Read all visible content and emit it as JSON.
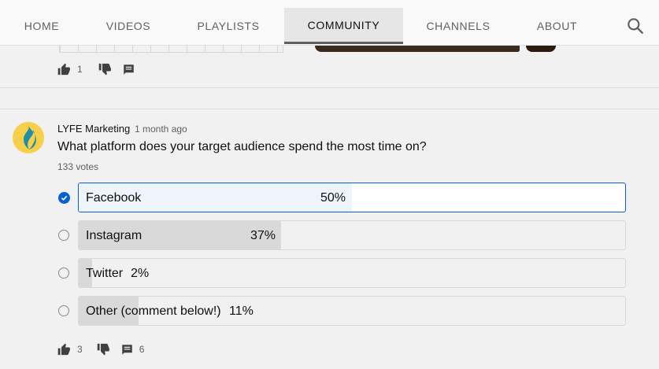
{
  "nav": {
    "tabs": [
      {
        "label": "HOME"
      },
      {
        "label": "VIDEOS"
      },
      {
        "label": "PLAYLISTS"
      },
      {
        "label": "COMMUNITY"
      },
      {
        "label": "CHANNELS"
      },
      {
        "label": "ABOUT"
      }
    ],
    "active_tab": "COMMUNITY",
    "search_icon": "search-icon"
  },
  "previous_post": {
    "likes": "1"
  },
  "post": {
    "author": "LYFE Marketing",
    "time": "1 month ago",
    "question": "What platform does your target audience spend the most time on?",
    "votes": "133 votes",
    "options": [
      {
        "label": "Facebook",
        "percent_text": "50%",
        "percent": 50,
        "selected": true
      },
      {
        "label": "Instagram",
        "percent_text": "37%",
        "percent": 37,
        "selected": false
      },
      {
        "label": "Twitter",
        "percent_text": "2%",
        "percent": 2,
        "selected": false
      },
      {
        "label": "Other (comment below!)",
        "percent_text": "11%",
        "percent": 11,
        "selected": false
      }
    ],
    "likes": "3",
    "comments": "6"
  },
  "colors": {
    "accent": "#065fd4",
    "avatar_bg": "#f7cf4b",
    "logo_teal": "#1f8fa6"
  }
}
